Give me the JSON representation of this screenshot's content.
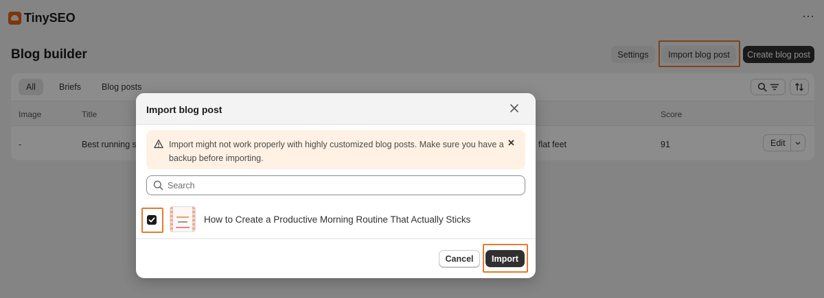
{
  "app": {
    "name": "TinySEO"
  },
  "page": {
    "title": "Blog builder",
    "buttons": {
      "settings": "Settings",
      "import": "Import blog post",
      "create": "Create blog post"
    }
  },
  "tabs": [
    "All",
    "Briefs",
    "Blog posts"
  ],
  "table": {
    "headers": {
      "image": "Image",
      "title": "Title",
      "score": "Score"
    },
    "rows": [
      {
        "image": "-",
        "title": "Best running sh",
        "keyword": "flat feet",
        "score": "91",
        "action": "Edit"
      }
    ]
  },
  "modal": {
    "title": "Import blog post",
    "warning": "Import might not work properly with highly customized blog posts. Make sure you have a backup before importing.",
    "search_placeholder": "Search",
    "items": [
      {
        "title": "How to Create a Productive Morning Routine That Actually Sticks",
        "checked": true
      }
    ],
    "cancel_label": "Cancel",
    "import_label": "Import"
  },
  "colors": {
    "highlight": "#e8782d",
    "primary_button": "#303030",
    "warning_bg": "#fff1e3"
  }
}
